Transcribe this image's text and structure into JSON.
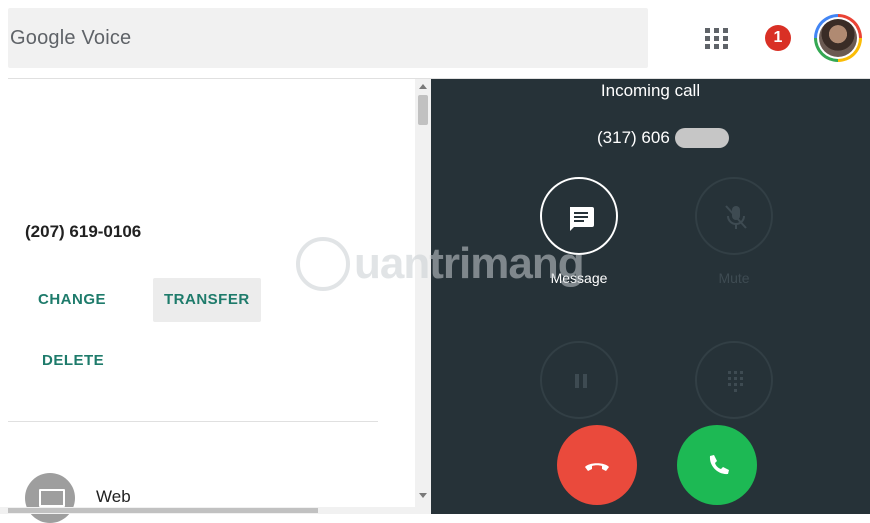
{
  "header": {
    "app_title": "Google Voice",
    "notification_count": "1",
    "apps_icon": "apps-grid-icon",
    "avatar_icon": "user-avatar"
  },
  "left_panel": {
    "phone_number": "(207) 619-0106",
    "buttons": {
      "change": "CHANGE",
      "transfer": "TRANSFER",
      "delete": "DELETE"
    },
    "device": {
      "label": "Web",
      "icon": "computer-icon"
    }
  },
  "call_panel": {
    "title": "Incoming call",
    "number_prefix": "(317) 606",
    "actions": {
      "message": "Message",
      "mute": "Mute"
    },
    "icons": [
      "message-icon",
      "mute-icon",
      "hold-icon",
      "dialpad-icon",
      "decline-icon",
      "answer-icon"
    ]
  },
  "watermark": {
    "text": "uantrimang"
  },
  "colors": {
    "accent_teal": "#1e7b6b",
    "call_panel_bg": "#263238",
    "decline_red": "#ea4a3c",
    "answer_green": "#1db954",
    "notification_red": "#d93025"
  }
}
